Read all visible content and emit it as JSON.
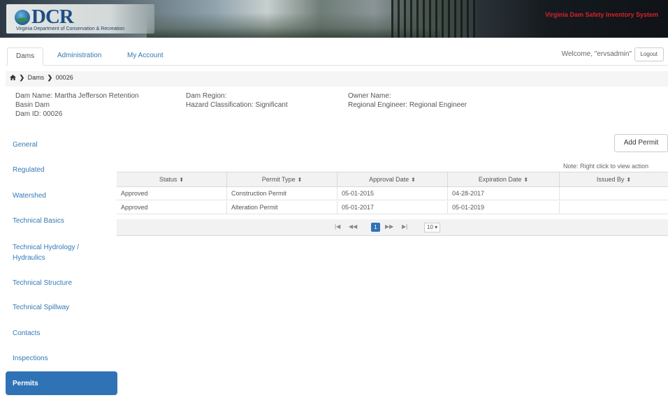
{
  "header": {
    "logo_text": "DCR",
    "logo_sub": "Virginia Department of Conservation & Recreation",
    "system_title": "Virginia Dam Safety Inventory System"
  },
  "nav": {
    "tabs": [
      "Dams",
      "Administration",
      "My Account"
    ],
    "welcome": "Welcome, \"ervsadmin\"",
    "logout": "Logout"
  },
  "breadcrumb": {
    "items": [
      "Dams",
      "00026"
    ]
  },
  "dam": {
    "name_line1": "Dam Name: Martha Jefferson Retention",
    "name_line2": "Basin Dam",
    "dam_id": "Dam ID: 00026",
    "region": "Dam Region:",
    "hazard": "Hazard Classification: Significant",
    "owner": "Owner Name:",
    "engineer": "Regional Engineer: Regional Engineer"
  },
  "sidebar": {
    "items": [
      {
        "label": "General"
      },
      {
        "label": "Regulated"
      },
      {
        "label": "Watershed"
      },
      {
        "label": "Technical Basics"
      },
      {
        "label": "Technical Hydrology / Hydraulics"
      },
      {
        "label": "Technical Structure"
      },
      {
        "label": "Technical Spillway"
      },
      {
        "label": "Contacts"
      },
      {
        "label": "Inspections"
      },
      {
        "label": "Permits"
      }
    ],
    "active_index": 9
  },
  "actions": {
    "add_permit": "Add Permit",
    "note": "Note: Right click to view action"
  },
  "table": {
    "columns": [
      "Status",
      "Permit Type",
      "Approval Date",
      "Expiration Date",
      "Issued By"
    ],
    "rows": [
      [
        "Approved",
        "Construction Permit",
        "05-01-2015",
        "04-28-2017",
        ""
      ],
      [
        "Approved",
        "Alteration Permit",
        "05-01-2017",
        "05-01-2019",
        ""
      ]
    ]
  },
  "pager": {
    "first": "|◀",
    "prev": "◀◀",
    "current": "1",
    "next": "▶▶",
    "last": "▶|",
    "page_size": "10 ▾"
  }
}
